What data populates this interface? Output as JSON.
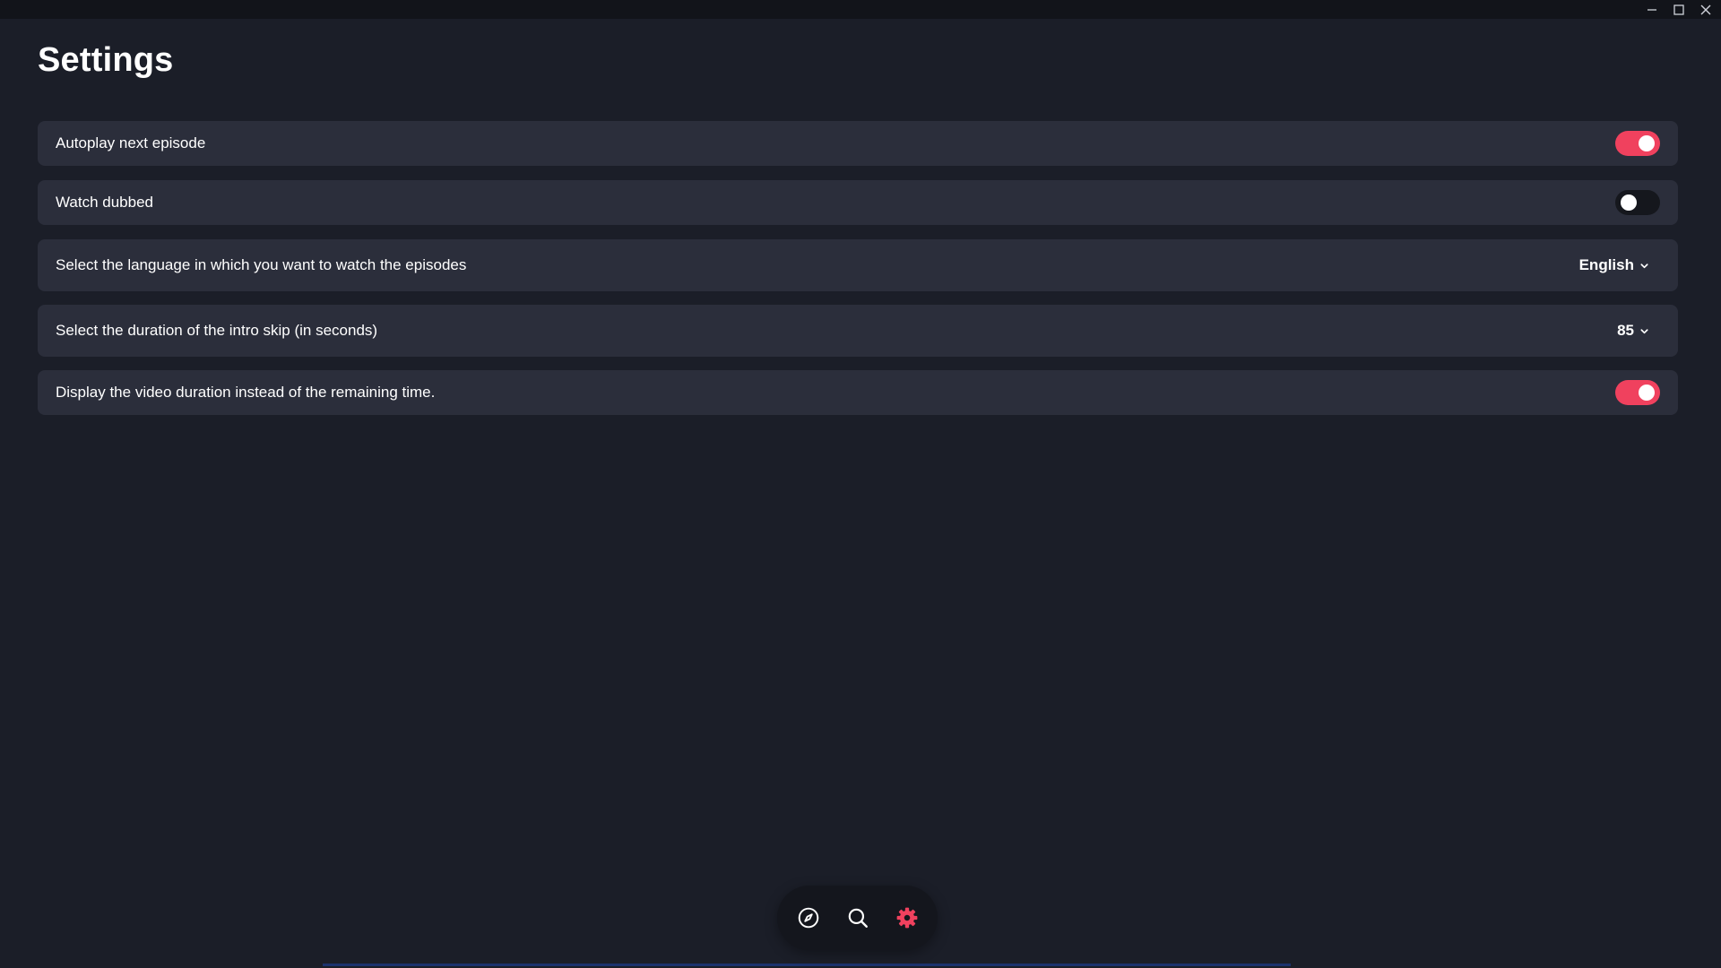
{
  "window": {
    "controls": [
      "minimize-icon",
      "maximize-icon",
      "close-icon"
    ]
  },
  "page": {
    "title": "Settings"
  },
  "settings": {
    "autoplay": {
      "label": "Autoplay next episode",
      "enabled": true
    },
    "dubbed": {
      "label": "Watch dubbed",
      "enabled": false
    },
    "language": {
      "label": "Select the language in which you want to watch the episodes",
      "value": "English"
    },
    "intro_skip": {
      "label": "Select the duration of the intro skip (in seconds)",
      "value": "85"
    },
    "duration_display": {
      "label": "Display the video duration instead of the remaining time.",
      "enabled": true
    }
  },
  "nav": {
    "items": [
      "compass-icon",
      "search-icon",
      "gear-icon"
    ],
    "active": "gear-icon"
  },
  "colors": {
    "accent": "#f0415e",
    "background": "#1b1e28",
    "row": "#2b2e3b",
    "toggle_off": "#15171d"
  }
}
